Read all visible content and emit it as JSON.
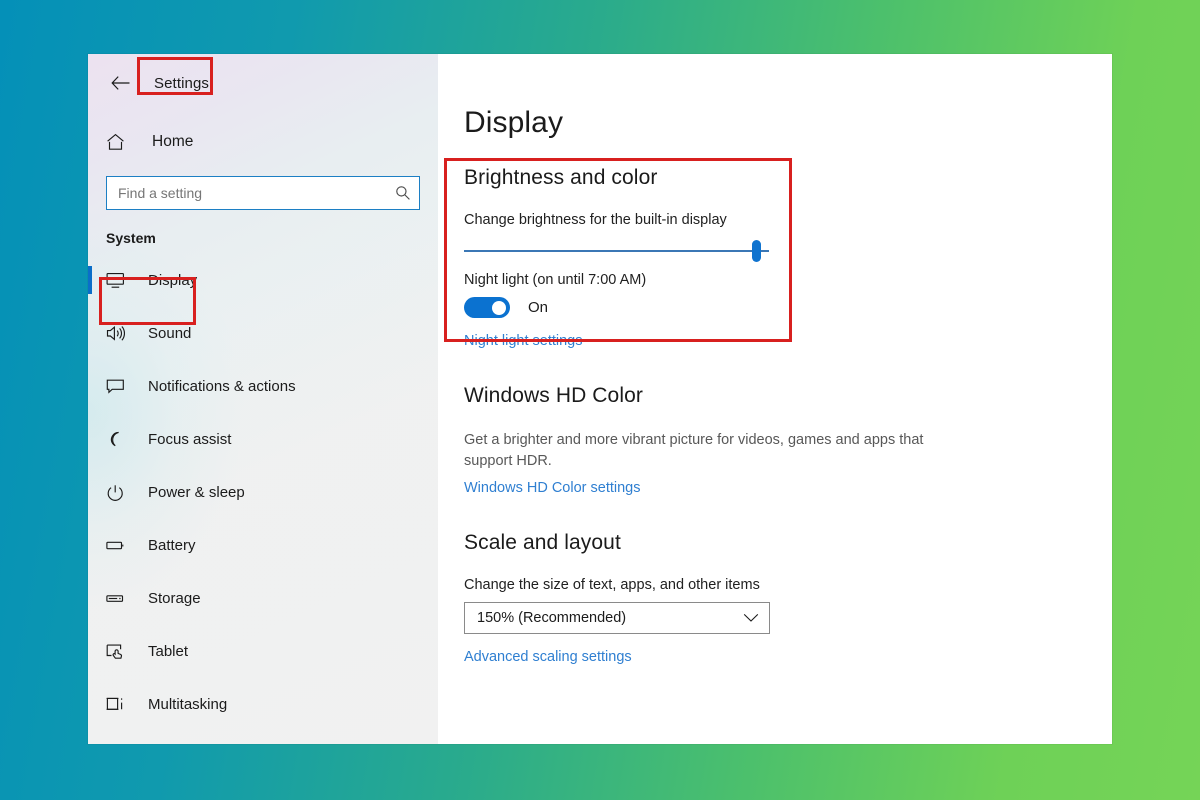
{
  "background": {
    "gradient_from": "#0490b8",
    "gradient_to": "#75d457"
  },
  "window": {
    "title": "Settings",
    "back_icon": "back-arrow-icon"
  },
  "sidebar": {
    "home": {
      "label": "Home",
      "icon": "home-icon"
    },
    "search": {
      "placeholder": "Find a setting",
      "value": "",
      "icon": "search-icon"
    },
    "group_label": "System",
    "items": [
      {
        "label": "Display",
        "icon": "monitor-icon",
        "selected": true
      },
      {
        "label": "Sound",
        "icon": "speaker-icon",
        "selected": false
      },
      {
        "label": "Notifications & actions",
        "icon": "notification-icon",
        "selected": false
      },
      {
        "label": "Focus assist",
        "icon": "moon-icon",
        "selected": false
      },
      {
        "label": "Power & sleep",
        "icon": "power-icon",
        "selected": false
      },
      {
        "label": "Battery",
        "icon": "battery-icon",
        "selected": false
      },
      {
        "label": "Storage",
        "icon": "storage-icon",
        "selected": false
      },
      {
        "label": "Tablet",
        "icon": "tablet-icon",
        "selected": false
      },
      {
        "label": "Multitasking",
        "icon": "multitasking-icon",
        "selected": false
      }
    ],
    "accent_color": "#0b6ec9"
  },
  "main": {
    "page_title": "Display",
    "brightness_section": {
      "title": "Brightness and color",
      "brightness_label": "Change brightness for the built-in display",
      "brightness_value_percent": 96,
      "night_light_label": "Night light (on until 7:00 AM)",
      "night_light_state": "On",
      "night_light_on": true,
      "night_light_link": "Night light settings",
      "toggle_color": "#0b72d0",
      "slider_color": "#0f73cf"
    },
    "hd_color_section": {
      "title": "Windows HD Color",
      "description": "Get a brighter and more vibrant picture for videos, games and apps that support HDR.",
      "link": "Windows HD Color settings"
    },
    "scale_section": {
      "title": "Scale and layout",
      "label": "Change the size of text, apps, and other items",
      "selected_scale": "150% (Recommended)",
      "link": "Advanced scaling settings"
    },
    "link_color": "#2f7fd1"
  },
  "annotations": {
    "color": "#d8201f",
    "boxes": [
      "settings-title",
      "display-nav-item",
      "brightness-and-color-section"
    ]
  }
}
